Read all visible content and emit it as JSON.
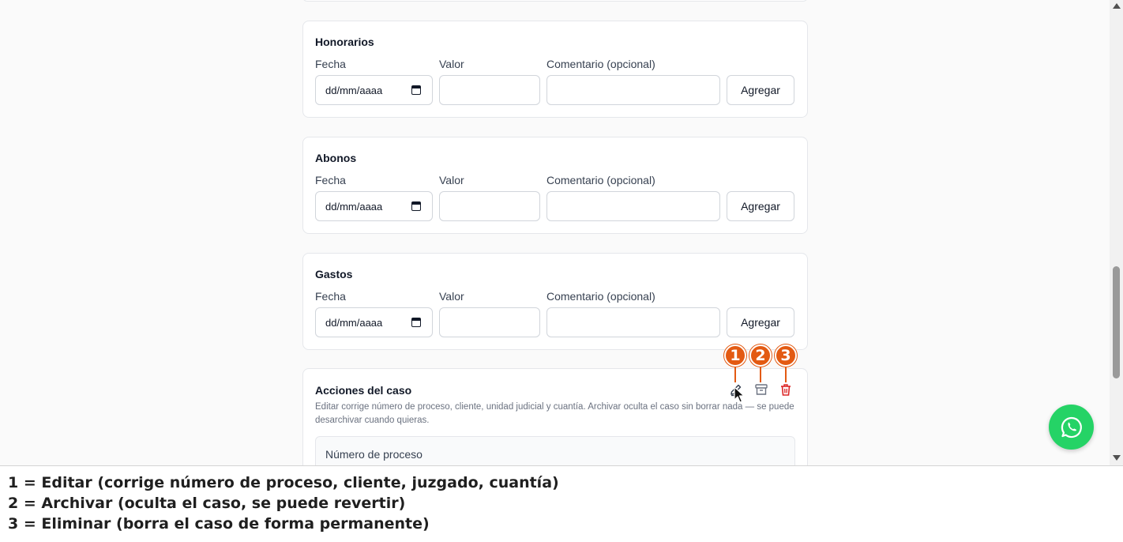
{
  "sections": [
    {
      "title": "Honorarios",
      "date_label": "Fecha",
      "value_label": "Valor",
      "comment_label": "Comentario (opcional)",
      "date_placeholder": "dd/mm/aaaa",
      "button_label": "Agregar"
    },
    {
      "title": "Abonos",
      "date_label": "Fecha",
      "value_label": "Valor",
      "comment_label": "Comentario (opcional)",
      "date_placeholder": "dd/mm/aaaa",
      "button_label": "Agregar"
    },
    {
      "title": "Gastos",
      "date_label": "Fecha",
      "value_label": "Valor",
      "comment_label": "Comentario (opcional)",
      "date_placeholder": "dd/mm/aaaa",
      "button_label": "Agregar"
    }
  ],
  "case_actions": {
    "title": "Acciones del caso",
    "description": "Editar corrige número de proceso, cliente, unidad judicial y cuantía. Archivar oculta el caso sin borrar nada — se puede desarchivar cuando quieras.",
    "field_label": "Número de proceso",
    "icons": [
      "edit-icon",
      "archive-icon",
      "trash-icon"
    ],
    "markers": [
      "1",
      "2",
      "3"
    ]
  },
  "legend": [
    "1 = Editar (corrige número de proceso, cliente, juzgado, cuantía)",
    "2 = Archivar (oculta el caso, se puede revertir)",
    "3 = Eliminar (borra el caso de forma permanente)"
  ],
  "colors": {
    "marker": "#e35a12",
    "delete": "#dc2626",
    "whatsapp": "#25d366"
  }
}
